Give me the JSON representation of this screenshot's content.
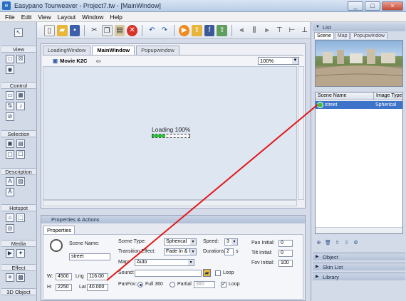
{
  "window": {
    "title": "Easypano Tourweaver - Project7.tw - [MainWindow]",
    "buttons": [
      "_",
      "□",
      "×"
    ]
  },
  "menu": [
    "File",
    "Edit",
    "View",
    "Layout",
    "Window",
    "Help"
  ],
  "left_panel": {
    "sections": [
      "View",
      "Control",
      "Selection",
      "Description",
      "Hotspot",
      "Media",
      "Effect",
      "3D Object"
    ]
  },
  "main": {
    "tabs": [
      "LoadingWindow",
      "MainWindow",
      "Popupwindow"
    ],
    "movie_label": "Movie K2C",
    "zoom": "100%",
    "loading_text": "Loading 100%",
    "loading_progress": 0.35
  },
  "properties": {
    "header": "Properties & Actions",
    "tab": "Properties",
    "scene_name_label": "Scene Name:",
    "scene_name_value": "street",
    "w_label": "W:",
    "w_value": "4500",
    "h_label": "H:",
    "h_value": "2250",
    "lng_label": "Lng",
    "lng_value": "116.00",
    "lat_label": "Lat",
    "lat_value": "40.000",
    "scene_type_label": "Scene Type:",
    "scene_type_value": "Spherical",
    "transition_label": "Transition Effect:",
    "transition_value": "Fade In & I",
    "map_label": "Map:",
    "map_value": "Auto",
    "sound_label": "Sound:",
    "speed_label": "Speed:",
    "speed_value": "3",
    "durations_label": "Durations:",
    "durations_value": "2",
    "durations_unit": "s",
    "loop_label": "Loop",
    "panfov_label": "PanFov:",
    "full360_label": "Full 360",
    "partial_label": "Partial",
    "partial_value": "360",
    "loop2_label": "Loop",
    "pan_initial_label": "Pan  Initial:",
    "pan_initial_value": "0",
    "tilt_initial_label": "Tilt  Initial:",
    "tilt_initial_value": "0",
    "fov_initial_label": "Fov  Initial:",
    "fov_initial_value": "100"
  },
  "right_panel": {
    "header": "List",
    "tabs": [
      "Scene",
      "Map",
      "Popupwindow"
    ],
    "columns": [
      "Scene Name",
      "Image Type"
    ],
    "rows": [
      {
        "name": "street",
        "type": "Spherical"
      }
    ],
    "collapsed": [
      "Object",
      "Skin List",
      "Library"
    ]
  }
}
